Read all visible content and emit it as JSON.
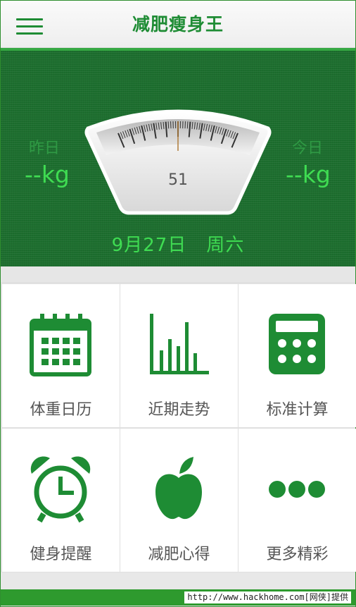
{
  "header": {
    "title": "减肥瘦身王",
    "menu_icon": "hamburger-menu-icon"
  },
  "weight_panel": {
    "yesterday_label": "昨日",
    "yesterday_value": "--kg",
    "today_label": "今日",
    "today_value": "--kg",
    "scale_reading": "51",
    "date": "9月27日",
    "weekday": "周六"
  },
  "tiles": [
    {
      "label": "体重日历",
      "icon": "calendar-icon"
    },
    {
      "label": "近期走势",
      "icon": "bar-chart-icon"
    },
    {
      "label": "标准计算",
      "icon": "calculator-icon"
    },
    {
      "label": "健身提醒",
      "icon": "alarm-clock-icon"
    },
    {
      "label": "减肥心得",
      "icon": "apple-icon"
    },
    {
      "label": "更多精彩",
      "icon": "more-dots-icon"
    }
  ],
  "footer": {
    "watermark": "http://www.hackhome.com[网侠]提供"
  },
  "colors": {
    "primary_green": "#1e8c34",
    "panel_green": "#1c6e2e",
    "digit_green": "#3fdc52"
  }
}
